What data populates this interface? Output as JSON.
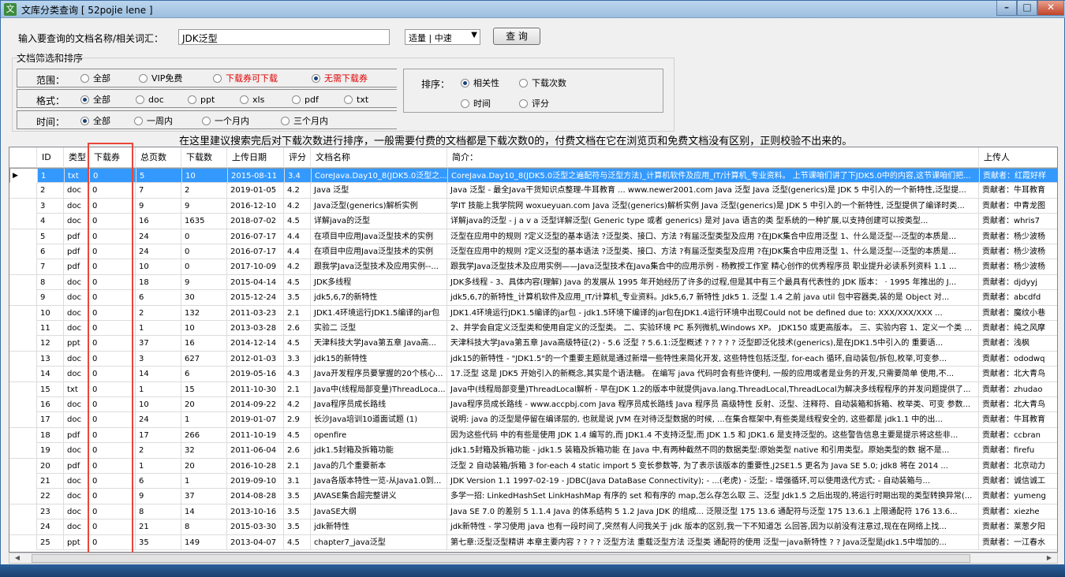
{
  "window": {
    "title": "文库分类查询 [ 52pojie lene ]",
    "app_icon": "文"
  },
  "search": {
    "label": "输入要查询的文档名称/相关词汇：",
    "value": "JDK泛型",
    "mode": "适量 | 中速",
    "button": "查 询"
  },
  "filter": {
    "legend": "文档筛选和排序",
    "range_label": "范围：",
    "range": [
      "全部",
      "VIP免费",
      "下载券可下载",
      "无需下载券"
    ],
    "format_label": "格式：",
    "format": [
      "全部",
      "doc",
      "ppt",
      "xls",
      "pdf",
      "txt"
    ],
    "time_label": "时间：",
    "time": [
      "全部",
      "一周内",
      "一个月内",
      "三个月内"
    ],
    "sort_label": "排序：",
    "sort": [
      "相关性",
      "下载次数",
      "时间",
      "评分"
    ]
  },
  "note": "在这里建议搜索完后对下载次数进行排序，一般需要付费的文档都是下载次数0的，付费文档在它在浏览页和免费文档没有区别，正则校验不出来的。",
  "columns": [
    "ID",
    "类型",
    "下载券",
    "总页数",
    "下载数",
    "上传日期",
    "评分",
    "文档名称",
    "简介：",
    "上传人"
  ],
  "rows": [
    [
      "1",
      "txt",
      "0",
      "5",
      "10",
      "2015-08-11",
      "3.4",
      "CoreJava.Day10_8(JDK5.0泛型之...",
      "CoreJava.Day10_8(JDK5.0泛型之遍配符与泛型方法)_计算机软件及应用_IT/计算机_专业资料。 上节课咱们讲了下JDK5.0中的内容,这节课咱们把...",
      "贡献者：红霞好样"
    ],
    [
      "2",
      "doc",
      "0",
      "7",
      "2",
      "2019-01-05",
      "4.2",
      "Java 泛型",
      "Java 泛型 - 最全Java干货知识点整理-牛耳教育 ... www.newer2001.com Java 泛型 Java 泛型(generics)是 JDK 5 中引入的一个新特性,泛型提...",
      "贡献者：牛耳教育"
    ],
    [
      "3",
      "doc",
      "0",
      "9",
      "9",
      "2016-12-10",
      "4.2",
      "Java泛型(generics)解析实例",
      "学IT 技能上我学院网 woxueyuan.com Java 泛型(generics)解析实例 Java 泛型(generics)是 JDK 5 中引入的一个新特性, 泛型提供了编译时类...",
      "贡献者：中青龙图"
    ],
    [
      "4",
      "doc",
      "0",
      "16",
      "1635",
      "2018-07-02",
      "4.5",
      "详解java的泛型",
      "详解java的泛型 - j a v a 泛型详解泛型( Generic type 或者 generics) 是对 Java 语言的类 型系统的一种扩展,以支持创建可以按类型...",
      "贡献者：whris7"
    ],
    [
      "5",
      "pdf",
      "0",
      "24",
      "0",
      "2016-07-17",
      "4.4",
      "在项目中应用Java泛型技术的实例",
      "泛型在应用中的规则 ?定义泛型的基本语法 ?泛型类、接口、方法 ?有届泛型类型及应用 ?在JDK集合中应用泛型 1、什么是泛型---泛型的本质是...",
      "贡献者：杨少波杨"
    ],
    [
      "6",
      "pdf",
      "0",
      "24",
      "0",
      "2016-07-17",
      "4.4",
      "在项目中应用Java泛型技术的实例",
      "泛型在应用中的规则 ?定义泛型的基本语法 ?泛型类、接口、方法 ?有届泛型类型及应用 ?在JDK集合中应用泛型 1、什么是泛型---泛型的本质是...",
      "贡献者：杨少波杨"
    ],
    [
      "7",
      "pdf",
      "0",
      "10",
      "0",
      "2017-10-09",
      "4.2",
      "跟我学Java泛型技术及应用实例--...",
      "跟我学Java泛型技术及应用实例——Java泛型技术在Java集合中的应用示例 - 杨教授工作室 精心创作的优秀程序员 职业提升必读系列资料 1.1 ...",
      "贡献者：杨少波杨"
    ],
    [
      "8",
      "doc",
      "0",
      "18",
      "9",
      "2015-04-14",
      "4.5",
      "JDK多线程",
      "JDK多线程 - 3、具体内容(理解) Java 的发展从 1995 年开始经历了许多的过程,但是其中有三个最具有代表性的 JDK 版本： · 1995 年推出的 J...",
      "贡献者：djdyyj"
    ],
    [
      "9",
      "doc",
      "0",
      "6",
      "30",
      "2015-12-24",
      "3.5",
      "jdk5,6,7的新特性",
      "jdk5,6,7的新特性_计算机软件及应用_IT/计算机_专业资料。Jdk5,6,7 新特性 Jdk5 1. 泛型 1.4 之前 java util 包中容器类,装的是 Object 对...",
      "贡献者：abcdfd"
    ],
    [
      "10",
      "doc",
      "0",
      "2",
      "132",
      "2011-03-23",
      "2.1",
      "JDK1.4环境运行JDK1.5编译的jar包",
      "JDK1.4环境运行JDK1.5编译的jar包 - jdk1.5环境下编译的jar包在JDK1.4运行环境中出现Could not be defined due to: XXX/XXX/XXX ...",
      "贡献者：魔纹小巷"
    ],
    [
      "11",
      "doc",
      "0",
      "1",
      "10",
      "2013-03-28",
      "2.6",
      "实验二  泛型",
      "2、并学会自定义泛型类和使用自定义的泛型类。 二、实验环境 PC 系列微机,Windows XP。 JDK150 或更高版本。 三、实验内容 1、定义一个类 ...",
      "贡献者：纯之风摩"
    ],
    [
      "12",
      "ppt",
      "0",
      "37",
      "16",
      "2014-12-14",
      "4.5",
      "天津科技大学Java第五章  Java高...",
      "天津科技大学Java第五章 Java高级特征(2) - 5.6 泛型 ? 5.6.1:泛型概述 ? ? ? ? ? 泛型即泛化技术(generics),是在JDK1.5中引入的 重要语...",
      "贡献者：浅枫"
    ],
    [
      "13",
      "doc",
      "0",
      "3",
      "627",
      "2012-01-03",
      "3.3",
      "jdk15的新特性",
      "jdk15的新特性 - \"JDK1.5\"的一个重要主题就是通过新增一些特性来简化开发, 这些特性包括泛型, for-each 循环,自动装包/拆包,枚举,可变参...",
      "贡献者：ododwq"
    ],
    [
      "14",
      "doc",
      "0",
      "14",
      "6",
      "2019-05-16",
      "4.3",
      "Java开发程序员要掌握的20个核心...",
      "17.泛型 这是 JDK5 开始引入的新概念,其实是个语法糖。 在编写 java 代码时会有些许便利, 一般的应用或者是业务的开发,只需要简单 使用,不...",
      "贡献者：北大青鸟"
    ],
    [
      "15",
      "txt",
      "0",
      "1",
      "15",
      "2011-10-30",
      "2.1",
      "Java中(线程局部变量)ThreadLoca...",
      "Java中(线程局部变量)ThreadLocal解析 - 早在JDK 1.2的版本中就提供java.lang.ThreadLocal,ThreadLocal为解决多线程程序的并发问题提供了...",
      "贡献者：zhudao"
    ],
    [
      "16",
      "doc",
      "0",
      "10",
      "20",
      "2014-09-22",
      "4.2",
      "Java程序员成长路线",
      "Java程序员成长路线 - www.accpbj.com Java 程序员成长路线 Java 程序员 高级特性 反射、泛型、注释符、自动装箱和拆箱、枚举类、可变 参数...",
      "贡献者：北大青鸟"
    ],
    [
      "17",
      "doc",
      "0",
      "24",
      "1",
      "2019-01-07",
      "2.9",
      "长沙Java培训10道面试题 (1)",
      "说明: java 的泛型是停留在编译层的, 也就是说 JVM 在对待泛型数据的时候, ...在集合框架中,有些类是线程安全的, 这些都是 jdk1.1 中的出...",
      "贡献者：牛耳教育"
    ],
    [
      "18",
      "pdf",
      "0",
      "17",
      "266",
      "2011-10-19",
      "4.5",
      "openfire",
      "因为这些代码 中的有些是使用 JDK 1.4 编写的,而 JDK1.4 不支持泛型,而 JDK 1.5 和 JDK1.6 是支持泛型的。这些警告信息主要是提示将这些非...",
      "贡献者：ccbran"
    ],
    [
      "19",
      "doc",
      "0",
      "2",
      "32",
      "2011-06-04",
      "2.6",
      "jdk1.5封箱及拆箱功能",
      "jdk1.5封箱及拆箱功能 - jdk1.5 装箱及拆箱功能 在 Java 中,有两种截然不同的数据类型:原始类型 native 和引用类型。原始类型的数 据不是...",
      "贡献者：firefu"
    ],
    [
      "20",
      "pdf",
      "0",
      "1",
      "20",
      "2016-10-28",
      "2.1",
      "Java的几个重要新本",
      "泛型 2 自动装箱/拆箱 3 for-each 4 static import 5 变长参数等, 为了表示该版本的重要性,J2SE1.5 更名为 Java SE 5.0; jdk8 将在 2014 ...",
      "贡献者：北京动力"
    ],
    [
      "21",
      "doc",
      "0",
      "6",
      "1",
      "2019-09-10",
      "3.1",
      "Java各版本特性一览-从Java1.0到...",
      "JDK Version 1.1 1997-02-19 - JDBC(Java DataBase Connectivity); - ...(老虎) - 泛型; - 增强循环,可以使用迭代方式; - 自动装箱与...",
      "贡献者：诚信诚工"
    ],
    [
      "22",
      "doc",
      "0",
      "9",
      "37",
      "2014-08-28",
      "3.5",
      "JAVASE集合超完整讲义",
      "多学一招: LinkedHashSet LinkHashMap 有序的 set 和有序的 map,怎么存怎么取 三、泛型 Jdk1.5 之后出现的,将运行时期出现的类型转换异常(...",
      "贡献者：yumeng"
    ],
    [
      "23",
      "doc",
      "0",
      "8",
      "14",
      "2013-10-16",
      "3.5",
      "JavaSE大纲",
      "Java SE 7.0 的差别 5 1.1.4 Java 的体系结构 5 1.2 Java JDK 的组成... 泛限泛型 175 13.6 通配符与泛型 175 13.6.1 上限通配符 176 13.6...",
      "贡献者：xiezhe"
    ],
    [
      "24",
      "doc",
      "0",
      "21",
      "8",
      "2015-03-30",
      "3.5",
      "jdk新特性",
      "jdk新特性 - 学习使用 java 也有一段时间了,突然有人问我关于 jdk 版本的区别,我一下不知道怎 么回答,因为以前没有注意过,现在在网络上找...",
      "贡献者：莱葱夕阳"
    ],
    [
      "25",
      "ppt",
      "0",
      "35",
      "149",
      "2013-04-07",
      "4.5",
      "chapter7_java泛型",
      "第七章:泛型泛型精讲 本章主要内容 ? ? ? ? 泛型方法 重载泛型方法 泛型类 通配符的使用 泛型一java新特性 ? ? Java泛型是jdk1.5中增加的...",
      "贡献者：一江春水"
    ]
  ]
}
